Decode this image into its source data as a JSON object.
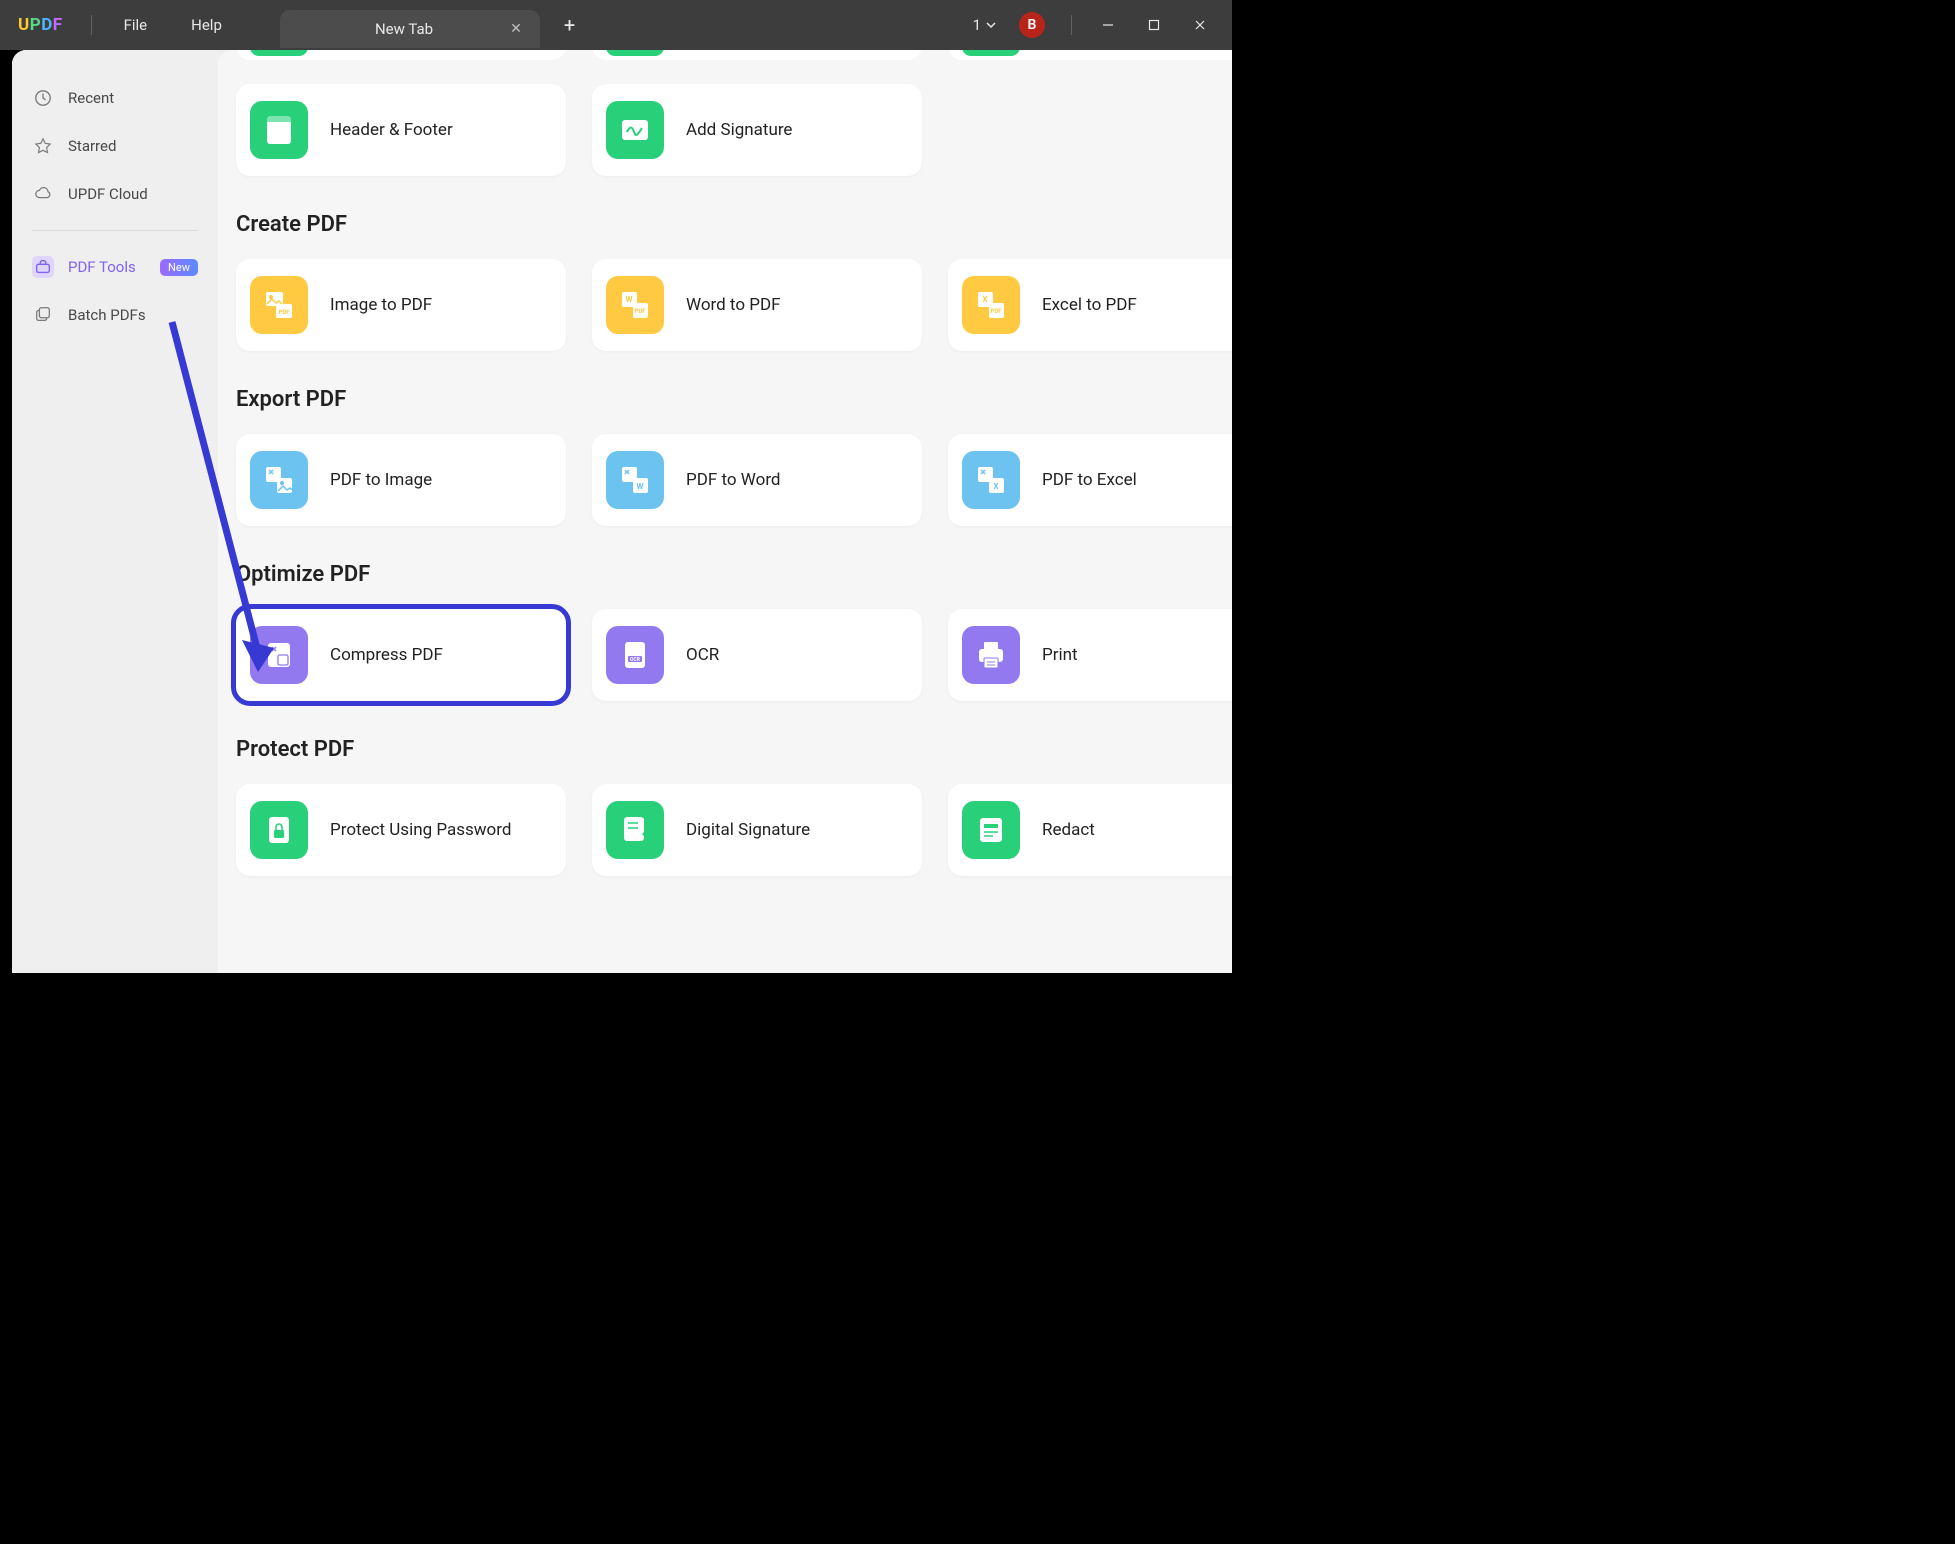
{
  "titlebar": {
    "menu_file": "File",
    "menu_help": "Help",
    "tab_title": "New Tab",
    "window_count": "1",
    "avatar_letter": "B"
  },
  "sidebar": {
    "recent": "Recent",
    "starred": "Starred",
    "cloud": "UPDF Cloud",
    "pdf_tools": "PDF Tools",
    "new_badge": "New",
    "batch": "Batch PDFs"
  },
  "sections": {
    "edit_tools": {
      "header_footer": "Header & Footer",
      "add_signature": "Add Signature"
    },
    "create": {
      "title": "Create PDF",
      "image_to_pdf": "Image to PDF",
      "word_to_pdf": "Word to PDF",
      "excel_to_pdf": "Excel to PDF"
    },
    "export": {
      "title": "Export PDF",
      "pdf_to_image": "PDF to Image",
      "pdf_to_word": "PDF to Word",
      "pdf_to_excel": "PDF to Excel"
    },
    "optimize": {
      "title": "Optimize PDF",
      "compress": "Compress PDF",
      "ocr": "OCR",
      "print": "Print"
    },
    "protect": {
      "title": "Protect PDF",
      "password": "Protect Using Password",
      "digital_sig": "Digital Signature",
      "redact": "Redact"
    }
  }
}
